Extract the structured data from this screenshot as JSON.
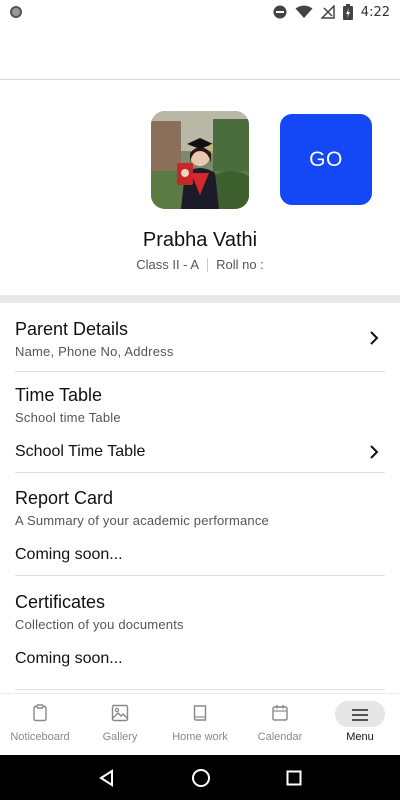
{
  "status_bar": {
    "time": "4:22",
    "icons": [
      "record-dot-icon",
      "do-not-disturb-icon",
      "wifi-icon",
      "no-signal-icon",
      "battery-charging-icon"
    ]
  },
  "profile": {
    "name": "Prabha Vathi",
    "class_label": "Class II - A",
    "roll_label": "Roll no :",
    "go_label": "GO",
    "go_color": "#1447f5"
  },
  "menu": {
    "parent_details": {
      "title": "Parent Details",
      "subtitle": "Name, Phone No,  Address"
    },
    "time_table": {
      "title": "Time Table",
      "subtitle": "School time Table",
      "row": "School Time Table"
    },
    "report_card": {
      "title": "Report Card",
      "subtitle": "A Summary of your academic performance",
      "row": "Coming soon..."
    },
    "certificates": {
      "title": "Certificates",
      "subtitle": "Collection of you documents",
      "row": "Coming soon..."
    }
  },
  "bottom_nav": {
    "items": [
      {
        "label": "Noticeboard",
        "icon": "clipboard-icon"
      },
      {
        "label": "Gallery",
        "icon": "image-icon"
      },
      {
        "label": "Home work",
        "icon": "book-icon"
      },
      {
        "label": "Calendar",
        "icon": "calendar-icon"
      },
      {
        "label": "Menu",
        "icon": "menu-icon",
        "active": true
      }
    ]
  },
  "system_nav": {
    "icons": [
      "back-icon",
      "home-icon",
      "recents-icon"
    ]
  }
}
